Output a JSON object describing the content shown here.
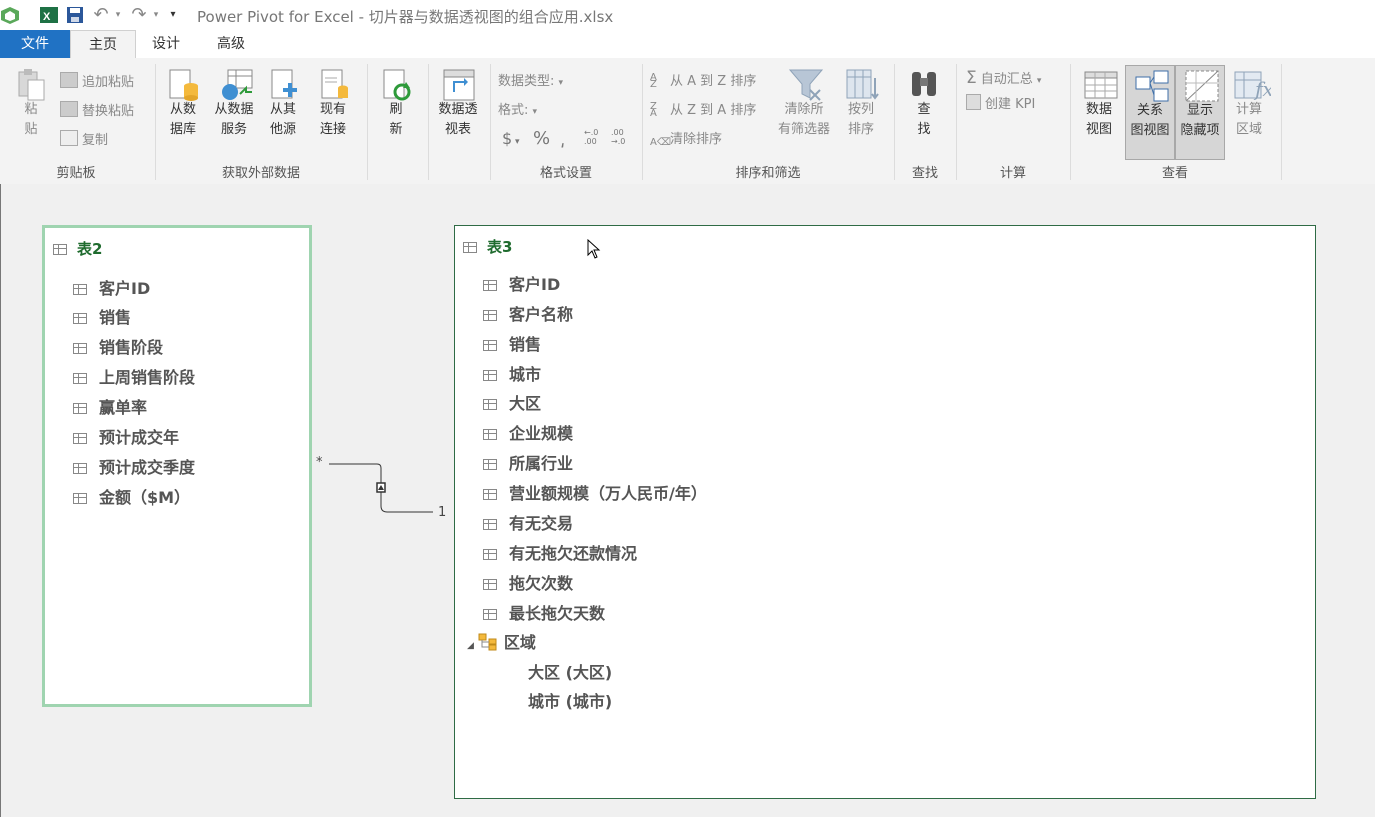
{
  "titlebar": {
    "title": "Power Pivot for Excel - 切片器与数据透视图的组合应用.xlsx"
  },
  "tabs": [
    {
      "label": "文件"
    },
    {
      "label": "主页"
    },
    {
      "label": "设计"
    },
    {
      "label": "高级"
    }
  ],
  "ribbon": {
    "clipboard": {
      "group": "剪贴板",
      "paste": "粘\n贴",
      "append_paste": "追加粘贴",
      "replace_paste": "替换粘贴",
      "copy": "复制"
    },
    "external": {
      "group": "获取外部数据",
      "from_db": "从数\n据库",
      "from_service": "从数据\n服务",
      "from_other": "从其\n他源",
      "existing": "现有\n连接"
    },
    "refresh": "刷\n新",
    "pivot": "数据透\n视表",
    "format": {
      "group": "格式设置",
      "data_type": "数据类型:",
      "format_label": "格式:",
      "currency": "$",
      "percent": "%",
      "comma": "͵",
      "inc_decimal": "←.0\n.00",
      "dec_decimal": ".00\n→.0"
    },
    "sort": {
      "group": "排序和筛选",
      "az": "从 A 到 Z 排序",
      "za": "从 Z 到 A 排序",
      "clear_sort": "清除排序",
      "clear_filters": "清除所\n有筛选器",
      "sort_by_col": "按列\n排序"
    },
    "find": {
      "group": "查找",
      "label": "查\n找"
    },
    "calc": {
      "group": "计算",
      "autosum": "自动汇总",
      "kpi": "创建 KPI"
    },
    "view": {
      "group": "查看",
      "data_view": "数据\n视图",
      "diagram_view": "关系\n图视图",
      "show_hidden": "显示\n隐藏项",
      "calc_area": "计算\n区域"
    }
  },
  "table2": {
    "title": "表2",
    "fields": [
      "客户ID",
      "销售",
      "销售阶段",
      "上周销售阶段",
      "赢单率",
      "预计成交年",
      "预计成交季度",
      "金额（$M）"
    ]
  },
  "table3": {
    "title": "表3",
    "fields": [
      "客户ID",
      "客户名称",
      "销售",
      "城市",
      "大区",
      "企业规模",
      "所属行业",
      "营业额规模（万人民币/年）",
      "有无交易",
      "有无拖欠还款情况",
      "拖欠次数",
      "最长拖欠天数"
    ],
    "hierarchy": {
      "name": "区域",
      "levels": [
        "大区 (大区)",
        "城市 (城市)"
      ]
    }
  },
  "relationship": {
    "many": "*",
    "one": "1"
  },
  "colors": {
    "file_tab": "#2072c4",
    "table2_border": "#9fd4b0",
    "table3_border": "#2f6b45",
    "table_title": "#1f6b2e"
  }
}
